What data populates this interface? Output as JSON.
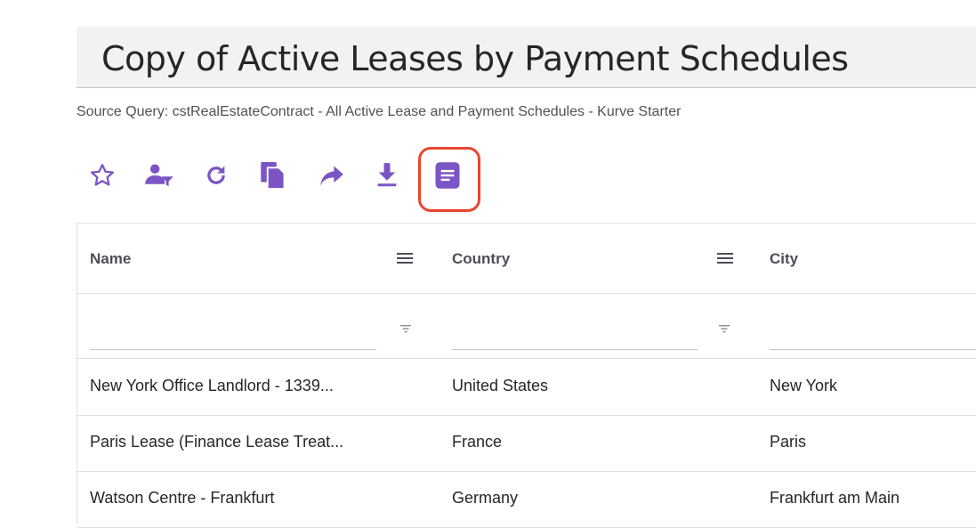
{
  "header": {
    "title": "Copy of Active Leases by Payment Schedules",
    "source_query": "Source Query: cstRealEstateContract - All Active Lease and Payment Schedules - Kurve Starter"
  },
  "toolbar": {
    "accent_color": "#7b55c4",
    "highlight_color": "#e8462f",
    "icons": [
      "star-icon",
      "user-filter-icon",
      "refresh-icon",
      "copy-icon",
      "share-icon",
      "download-icon",
      "document-icon"
    ]
  },
  "table": {
    "columns": [
      {
        "label": "Name"
      },
      {
        "label": "Country"
      },
      {
        "label": "City"
      }
    ],
    "rows": [
      {
        "name": "New York Office Landlord - 1339...",
        "country": "United States",
        "city": "New York"
      },
      {
        "name": "Paris Lease (Finance Lease Treat...",
        "country": "France",
        "city": "Paris"
      },
      {
        "name": "Watson Centre - Frankfurt",
        "country": "Germany",
        "city": "Frankfurt am Main"
      }
    ]
  }
}
